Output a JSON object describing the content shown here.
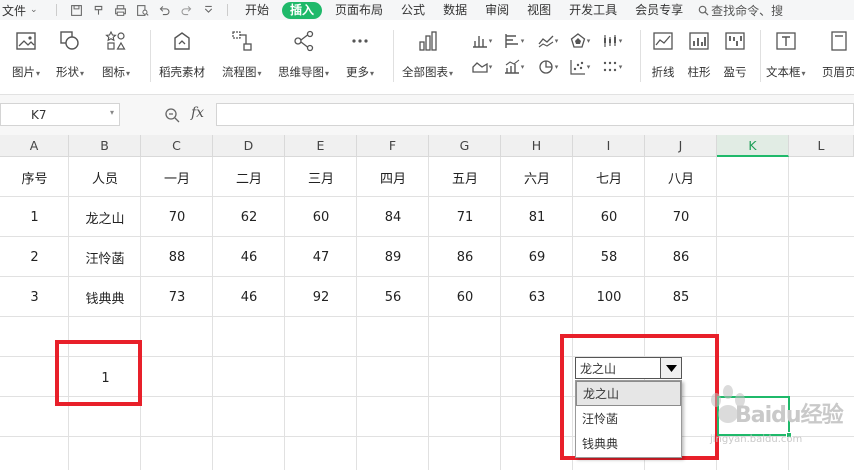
{
  "menubar": {
    "file_label": "文件",
    "tabs": [
      "开始",
      "插入",
      "页面布局",
      "公式",
      "数据",
      "审阅",
      "视图",
      "开发工具",
      "会员专享"
    ],
    "active_tab": "插入",
    "search_placeholder": "查找命令、搜"
  },
  "ribbon": {
    "picture": "图片",
    "shape": "形状",
    "icon": "图标",
    "docer_material": "稻壳素材",
    "flowchart": "流程图",
    "mindmap": "思维导图",
    "more": "更多",
    "all_charts": "全部图表",
    "sparkline_line": "折线",
    "sparkline_column": "柱形",
    "sparkline_winloss": "盈亏",
    "textbox": "文本框",
    "header_footer": "页眉页"
  },
  "formula_bar": {
    "name_box": "K7",
    "fx_label": "fx",
    "formula": ""
  },
  "grid": {
    "columns": [
      "A",
      "B",
      "C",
      "D",
      "E",
      "F",
      "G",
      "H",
      "I",
      "J",
      "K",
      "L"
    ],
    "active_column": "K",
    "header_row": [
      "序号",
      "人员",
      "一月",
      "二月",
      "三月",
      "四月",
      "五月",
      "六月",
      "七月",
      "八月"
    ],
    "rows": [
      [
        "1",
        "龙之山",
        "70",
        "62",
        "60",
        "84",
        "71",
        "81",
        "60",
        "70"
      ],
      [
        "2",
        "汪怜菡",
        "88",
        "46",
        "47",
        "89",
        "86",
        "69",
        "58",
        "86"
      ],
      [
        "3",
        "钱典典",
        "73",
        "46",
        "92",
        "56",
        "60",
        "63",
        "100",
        "85"
      ]
    ],
    "b10_value": "1"
  },
  "dropdown": {
    "selected": "龙之山",
    "options": [
      "龙之山",
      "汪怜菡",
      "钱典典"
    ]
  },
  "watermark": {
    "main": "Baidu经验",
    "sub": "jingyan.baidu.com"
  },
  "colors": {
    "accent": "#1fb96a",
    "highlight": "#e8202a"
  }
}
